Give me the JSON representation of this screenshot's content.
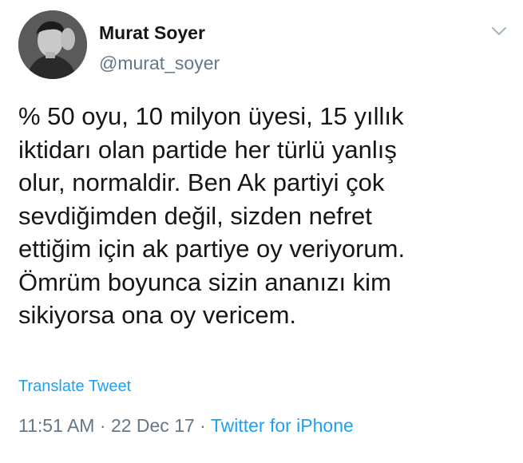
{
  "tweet": {
    "author": {
      "name": "Murat Soyer",
      "handle": "@murat_soyer"
    },
    "text_lines": [
      "% 50 oyu, 10 milyon üyesi, 15 yıllık",
      "iktidarı olan partide her türlü yanlış",
      "olur, normaldir. Ben Ak partiyi çok",
      "sevdiğimden değil, sizden nefret",
      "ettiğim için ak partiye oy veriyorum.",
      "Ömrüm boyunca sizin ananızı kim",
      "sikiyorsa ona oy vericem."
    ],
    "translate_label": "Translate Tweet",
    "time": "11:51 AM",
    "separator": " · ",
    "date": "22 Dec 17",
    "source": "Twitter for iPhone"
  },
  "icons": {
    "avatar": "profile-photo",
    "menu": "chevron-down-icon"
  },
  "colors": {
    "text": "#14171a",
    "secondary": "#657786",
    "link": "#1da1f2",
    "background": "#ffffff"
  }
}
